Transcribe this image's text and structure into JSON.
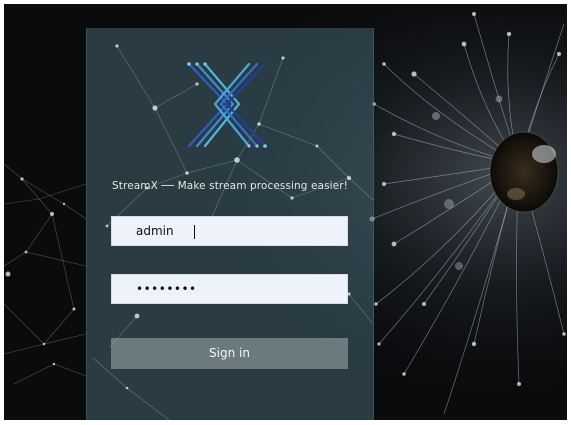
{
  "app": {
    "tagline": "StreamX ── Make stream processing easier!",
    "logo_name": "streamx-logo"
  },
  "form": {
    "username_value": "admin",
    "password_value": "••••••••",
    "signin_label": "Sign in"
  },
  "colors": {
    "panel": "#46646f",
    "input_bg": "#eef2fb",
    "button": "#a0afb2",
    "logo_blue": "#2a5cc8",
    "logo_cyan": "#4fb6e0"
  }
}
